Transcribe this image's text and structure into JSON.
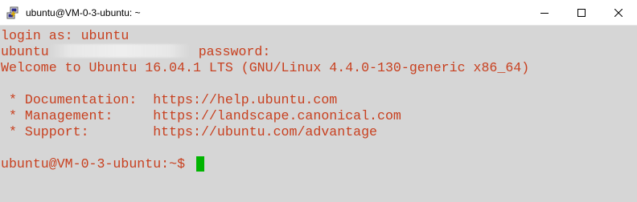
{
  "window": {
    "title": "ubuntu@VM-0-3-ubuntu: ~",
    "controls": {
      "minimize_icon": "minimize-icon",
      "maximize_icon": "maximize-icon",
      "close_icon": "close-icon"
    }
  },
  "terminal": {
    "colors": {
      "background": "#d6d6d6",
      "foreground": "#c8401f",
      "cursor": "#00b400"
    },
    "lines": {
      "login": "login as: ubuntu",
      "password_prefix": "ubuntu",
      "password_suffix": " password:",
      "welcome": "Welcome to Ubuntu 16.04.1 LTS (GNU/Linux 4.4.0-130-generic x86_64)",
      "blank1": "",
      "documentation": " * Documentation:  https://help.ubuntu.com",
      "management": " * Management:     https://landscape.canonical.com",
      "support": " * Support:        https://ubuntu.com/advantage",
      "blank2": "",
      "prompt": "ubuntu@VM-0-3-ubuntu:~$ "
    }
  }
}
